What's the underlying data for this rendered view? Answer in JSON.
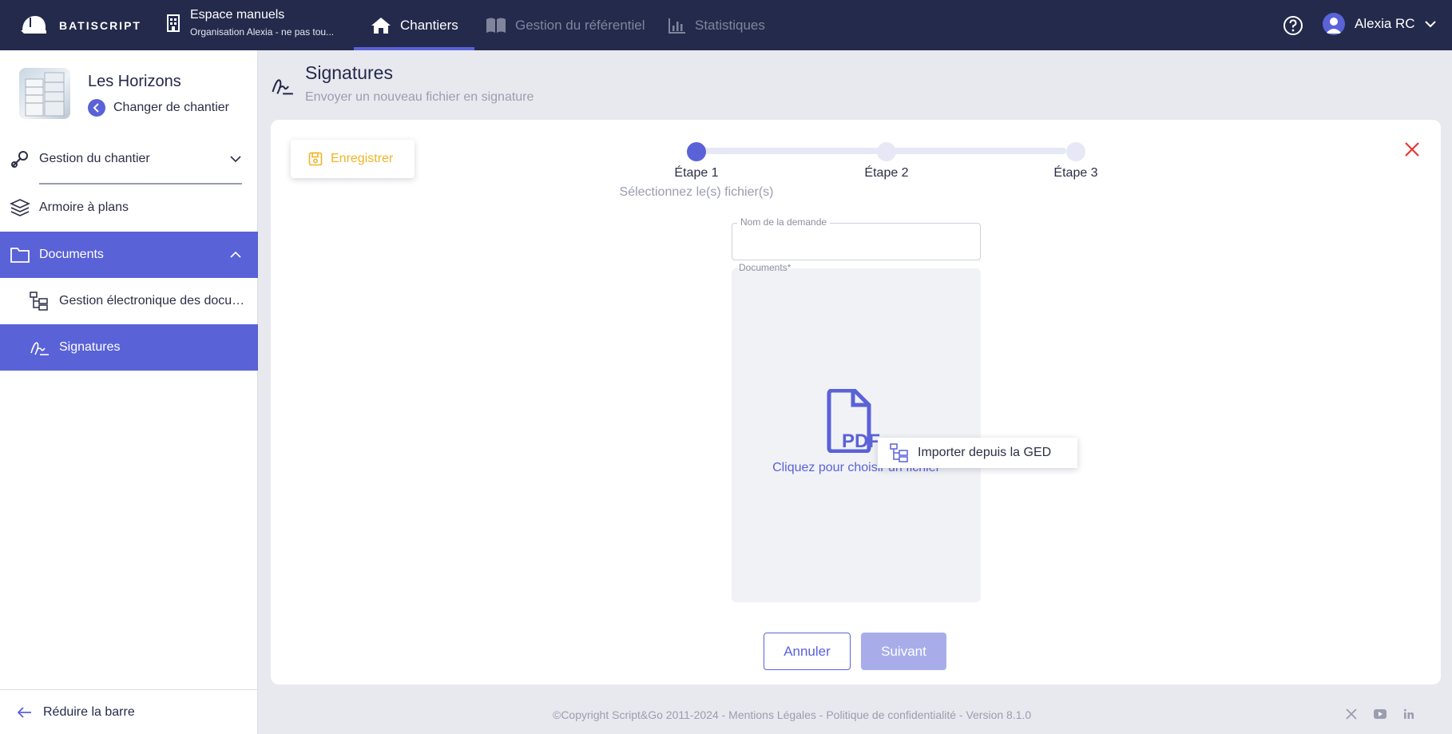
{
  "brand": {
    "name": "BATISCRIPT"
  },
  "workspace": {
    "title": "Espace manuels",
    "subtitle": "Organisation Alexia - ne pas tou..."
  },
  "nav": {
    "tabs": [
      {
        "label": "Chantiers",
        "icon": "home-icon",
        "active": true
      },
      {
        "label": "Gestion du référentiel",
        "icon": "book-icon",
        "active": false
      },
      {
        "label": "Statistiques",
        "icon": "chart-icon",
        "active": false
      }
    ]
  },
  "user": {
    "name": "Alexia RC"
  },
  "site": {
    "name": "Les Horizons",
    "change_label": "Changer de chantier"
  },
  "sidebar": {
    "items": [
      {
        "label": "Gestion du chantier",
        "icon": "tools-icon"
      },
      {
        "label": "Armoire à plans",
        "icon": "layers-icon"
      },
      {
        "label": "Documents",
        "icon": "folder-icon",
        "active": true
      },
      {
        "label": "Gestion électronique des documents",
        "icon": "tree-icon"
      },
      {
        "label": "Signatures",
        "icon": "signature-icon",
        "active": true
      }
    ],
    "collapse_label": "Réduire la barre"
  },
  "page": {
    "title": "Signatures",
    "subtitle": "Envoyer un nouveau fichier en signature"
  },
  "toolbar": {
    "save_label": "Enregistrer"
  },
  "stepper": {
    "steps": [
      {
        "label": "Étape 1",
        "description": "Sélectionnez le(s) fichier(s)",
        "active": true
      },
      {
        "label": "Étape 2",
        "active": false
      },
      {
        "label": "Étape 3",
        "active": false
      }
    ]
  },
  "form": {
    "request_name_label": "Nom de la demande",
    "request_name_value": "",
    "documents_label": "Documents*",
    "drop_text": "Cliquez pour choisir un fichier",
    "context_menu_item": "Importer depuis la GED"
  },
  "actions": {
    "cancel_label": "Annuler",
    "next_label": "Suivant"
  },
  "footer": {
    "text": "©Copyright Script&Go 2011-2024 - Mentions Légales - Politique de confidentialité - Version 8.1.0"
  },
  "colors": {
    "primary": "#5a62d8",
    "topbar": "#242a4b",
    "warning": "#f0b426",
    "danger": "#e53935"
  }
}
